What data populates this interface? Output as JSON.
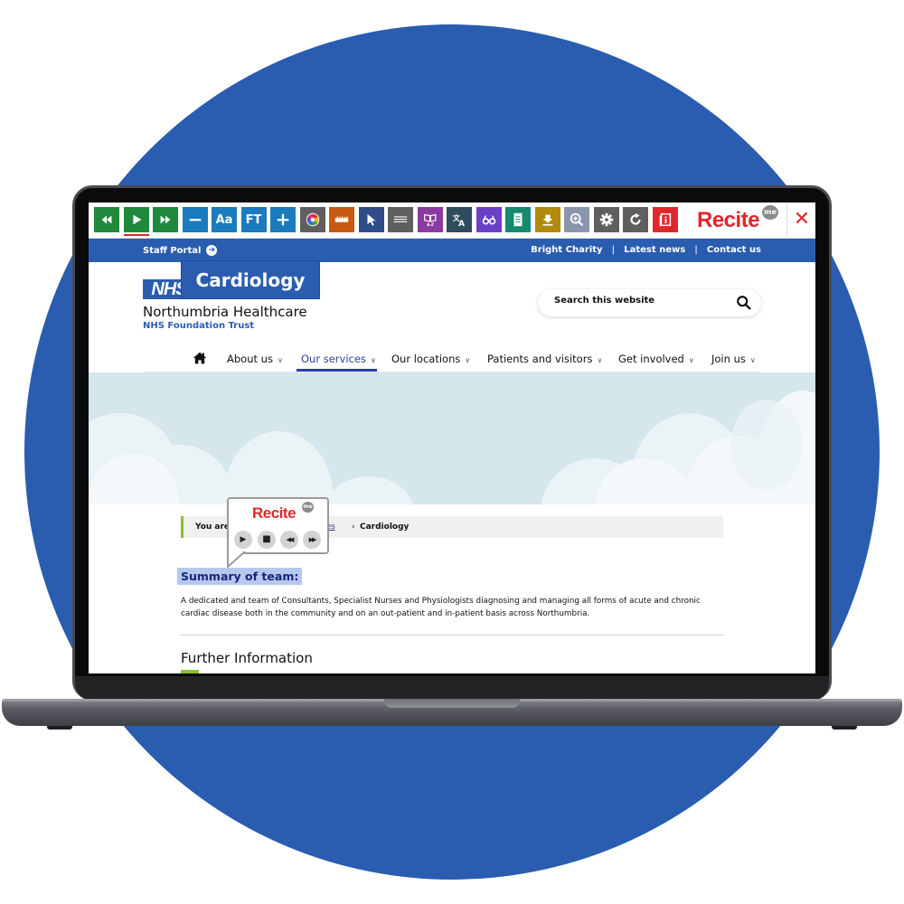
{
  "recite_toolbar": {
    "buttons": [
      {
        "name": "rewind",
        "label": "◀◀",
        "color": "#1e8a3c"
      },
      {
        "name": "play",
        "label": "▶",
        "color": "#1e8a3c",
        "active": true
      },
      {
        "name": "fast-forward",
        "label": "▶▶",
        "color": "#1e8a3c"
      },
      {
        "name": "decrease-text",
        "label": "—",
        "color": "#1a7bbf"
      },
      {
        "name": "font",
        "label": "Aa",
        "color": "#1a7bbf"
      },
      {
        "name": "font-type",
        "label": "FT",
        "color": "#1a7bbf"
      },
      {
        "name": "increase-text",
        "label": "+",
        "color": "#1a7bbf"
      },
      {
        "name": "color-wheel",
        "label": "",
        "color": "#5f5f5f"
      },
      {
        "name": "ruler",
        "label": "",
        "color": "#c85a10"
      },
      {
        "name": "cursor",
        "label": "",
        "color": "#2f4b8a"
      },
      {
        "name": "margins",
        "label": "",
        "color": "#5f5f5f"
      },
      {
        "name": "dictionary",
        "label": "A-Z",
        "color": "#8a3aa0"
      },
      {
        "name": "translate",
        "label": "文A",
        "color": "#2f4b5e"
      },
      {
        "name": "screen-mask",
        "label": "",
        "color": "#6a40c8"
      },
      {
        "name": "text-only",
        "label": "",
        "color": "#158a6e"
      },
      {
        "name": "download",
        "label": "",
        "color": "#b08a0a"
      },
      {
        "name": "magnifier",
        "label": "",
        "color": "#8a96ae"
      },
      {
        "name": "settings",
        "label": "",
        "color": "#5f5f5f"
      },
      {
        "name": "reset",
        "label": "",
        "color": "#5f5f5f"
      },
      {
        "name": "info",
        "label": "",
        "color": "#e3262b"
      }
    ],
    "logo": "Recite",
    "logo_badge": "me",
    "close_label": "✕"
  },
  "utility_bar": {
    "staff_portal": "Staff Portal",
    "links": [
      "Bright Charity",
      "Latest news",
      "Contact us"
    ],
    "separator": "|"
  },
  "header": {
    "logo": "NHS",
    "org_name": "Northumbria Healthcare",
    "org_sub": "NHS Foundation Trust",
    "search_placeholder": "Search this website"
  },
  "nav": {
    "items": [
      "About us",
      "Our services",
      "Our locations",
      "Patients and visitors",
      "Get involved",
      "Join us"
    ],
    "active": "Our services",
    "chevron": "⌄"
  },
  "hero": {
    "title": "Cardiology"
  },
  "breadcrumb": {
    "prefix": "You are",
    "parent": "ices",
    "separator": "›",
    "current": "Cardiology"
  },
  "player": {
    "logo": "Recite",
    "badge": "me",
    "buttons": [
      "▶",
      "■",
      "◀◀",
      "▶▶"
    ]
  },
  "content": {
    "summary_heading": "Summary of team:",
    "paragraph": "A dedicated and team of Consultants, Specialist Nurses and Physiologists diagnosing and managing all forms of acute and chronic cardiac disease both in the community and on an out-patient and in-patient basis across Northumbria.",
    "further_heading": "Further Information"
  },
  "colors": {
    "brand_blue": "#2a5db0",
    "recite_red": "#e3262b",
    "accent_green": "#8bbd3a",
    "highlight": "#b6c8ee"
  }
}
